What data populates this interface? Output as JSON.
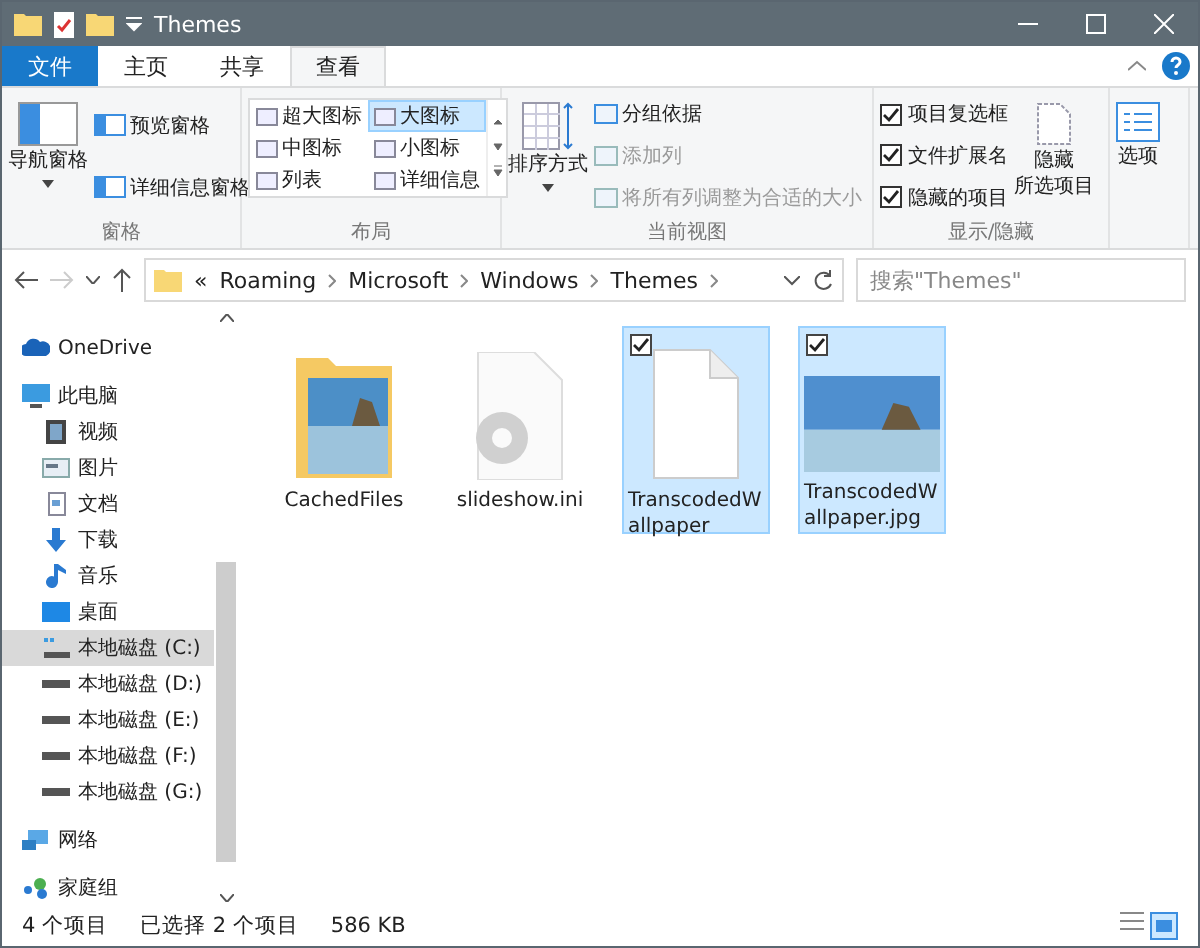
{
  "title_bar": {
    "title": "Themes"
  },
  "ribbon_tabs": [
    {
      "label": "文件",
      "kind": "file",
      "selected": false
    },
    {
      "label": "主页",
      "kind": "tab",
      "selected": false
    },
    {
      "label": "共享",
      "kind": "tab",
      "selected": false
    },
    {
      "label": "查看",
      "kind": "tab",
      "selected": true
    }
  ],
  "ribbon": {
    "panes": {
      "label": "窗格",
      "nav": "导航窗格",
      "buttons": [
        "预览窗格",
        "详细信息窗格"
      ]
    },
    "layout": {
      "label": "布局",
      "options": [
        {
          "label": "超大图标",
          "selected": false
        },
        {
          "label": "大图标",
          "selected": true
        },
        {
          "label": "中图标",
          "selected": false
        },
        {
          "label": "小图标",
          "selected": false
        },
        {
          "label": "列表",
          "selected": false
        },
        {
          "label": "详细信息",
          "selected": false
        }
      ]
    },
    "current_view": {
      "label": "当前视图",
      "sort": "排序方式",
      "items": [
        {
          "label": "分组依据",
          "disabled": false
        },
        {
          "label": "添加列",
          "disabled": true
        },
        {
          "label": "将所有列调整为合适的大小",
          "disabled": true
        }
      ]
    },
    "show_hide": {
      "label": "显示/隐藏",
      "checks": [
        {
          "label": "项目复选框",
          "checked": true
        },
        {
          "label": "文件扩展名",
          "checked": true
        },
        {
          "label": "隐藏的项目",
          "checked": true
        }
      ],
      "hide_button": [
        "隐藏",
        "所选项目"
      ]
    },
    "options": {
      "label": "选项"
    }
  },
  "address": {
    "prefix": "«",
    "path": [
      "Roaming",
      "Microsoft",
      "Windows",
      "Themes"
    ],
    "search_placeholder": "搜索\"Themes\""
  },
  "sidebar": [
    {
      "label": "OneDrive",
      "kind": "cloud",
      "selected": false
    },
    {
      "label": "此电脑",
      "kind": "pc",
      "selected": false,
      "children": [
        {
          "label": "视频",
          "kind": "video",
          "selected": false
        },
        {
          "label": "图片",
          "kind": "pictures",
          "selected": false
        },
        {
          "label": "文档",
          "kind": "documents",
          "selected": false
        },
        {
          "label": "下载",
          "kind": "download",
          "selected": false
        },
        {
          "label": "音乐",
          "kind": "music",
          "selected": false
        },
        {
          "label": "桌面",
          "kind": "desktop",
          "selected": false
        },
        {
          "label": "本地磁盘 (C:)",
          "kind": "system-drive",
          "selected": true
        },
        {
          "label": "本地磁盘 (D:)",
          "kind": "drive",
          "selected": false
        },
        {
          "label": "本地磁盘 (E:)",
          "kind": "drive",
          "selected": false
        },
        {
          "label": "本地磁盘 (F:)",
          "kind": "drive",
          "selected": false
        },
        {
          "label": "本地磁盘 (G:)",
          "kind": "drive",
          "selected": false
        }
      ]
    },
    {
      "label": "网络",
      "kind": "network",
      "selected": false
    },
    {
      "label": "家庭组",
      "kind": "homegroup",
      "selected": false
    }
  ],
  "files": [
    {
      "name": "CachedFiles",
      "kind": "folder",
      "selected": false
    },
    {
      "name": "slideshow.ini",
      "kind": "settings",
      "selected": false
    },
    {
      "name": "TranscodedWallpaper",
      "kind": "blank",
      "selected": true
    },
    {
      "name": "TranscodedWallpaper.jpg",
      "kind": "image",
      "selected": true
    }
  ],
  "status_bar": {
    "count": "4 个项目",
    "selection": "已选择 2 个项目",
    "size": "586 KB"
  }
}
